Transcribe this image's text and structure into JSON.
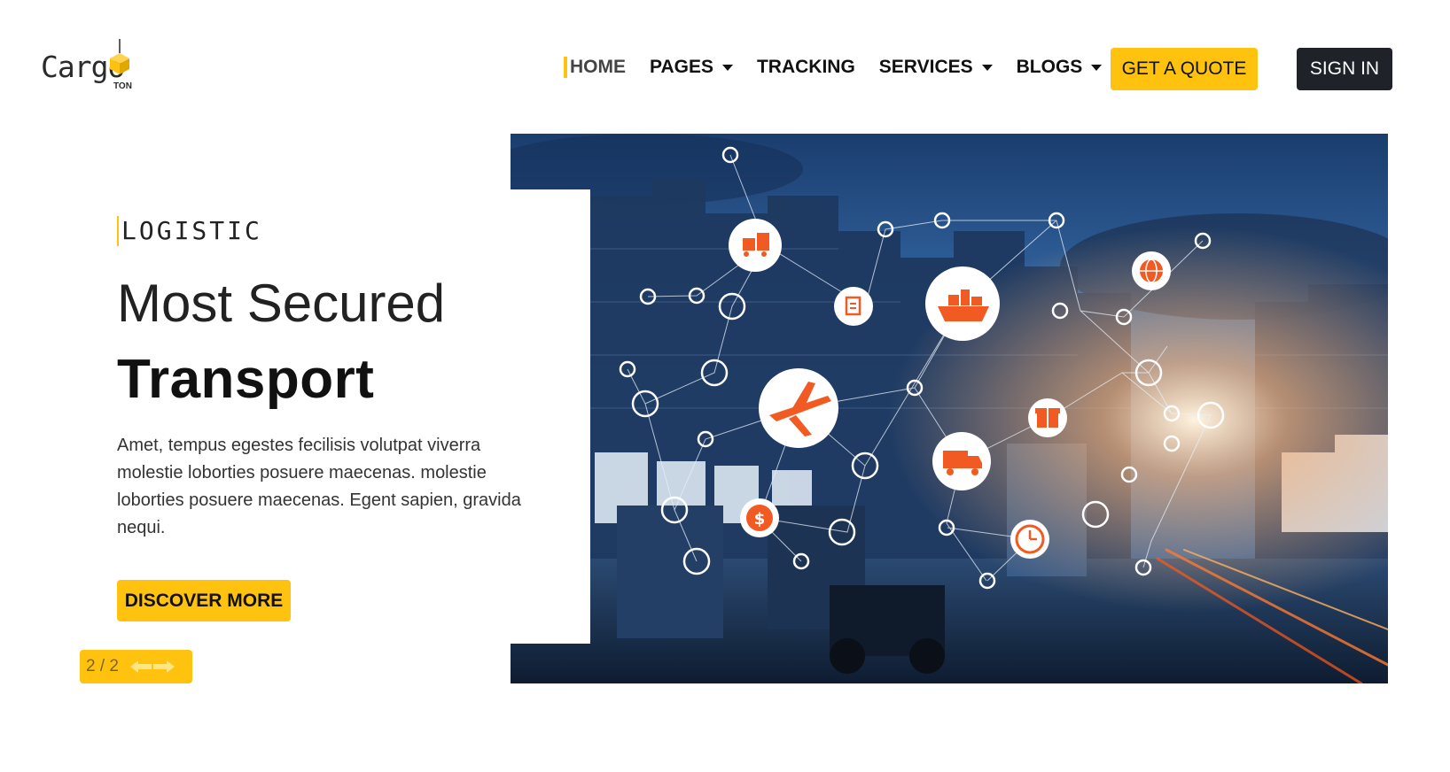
{
  "brand": {
    "name": "Cargo",
    "sub": "TON",
    "accent": "#ffc20e",
    "dark": "#1f2329"
  },
  "nav": {
    "items": [
      {
        "label": "HOME",
        "active": true,
        "dropdown": false
      },
      {
        "label": "PAGES",
        "active": false,
        "dropdown": true
      },
      {
        "label": "TRACKING",
        "active": false,
        "dropdown": false
      },
      {
        "label": "SERVICES",
        "active": false,
        "dropdown": true
      },
      {
        "label": "BLOGS",
        "active": false,
        "dropdown": true
      }
    ],
    "quote_label": "GET A QUOTE",
    "signin_label": "SIGN IN"
  },
  "hero": {
    "eyebrow": "LOGISTIC",
    "title_light": "Most Secured",
    "title_bold": "Transport",
    "description": "Amet, tempus egestes fecilisis volutpat viverra molestie loborties posuere maecenas. molestie loborties posuere maecenas. Egent sapien, gravida nequi.",
    "cta_label": "DISCOVER MORE"
  },
  "slider": {
    "counter": "2 / 2",
    "prev_icon": "arrow-left-icon",
    "next_icon": "arrow-right-icon"
  }
}
